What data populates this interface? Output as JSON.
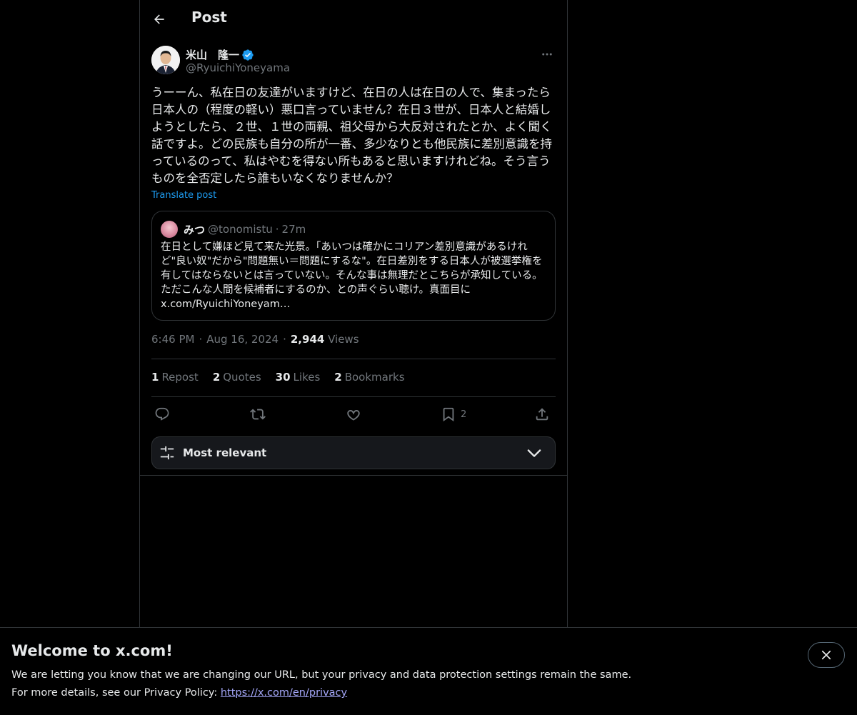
{
  "header": {
    "title": "Post"
  },
  "post": {
    "author": {
      "name": "米山　隆一",
      "handle": "@RyuichiYoneyama",
      "verified": true
    },
    "text": "うーーん、私在日の友達がいますけど、在日の人は在日の人で、集まったら日本人の（程度の軽い）悪口言っていません？在日３世が、日本人と結婚しようとしたら、２世、１世の両親、祖父母から大反対されたとか、よく聞く話ですよ。どの民族も自分の所が一番、多少なりとも他民族に差別意識を持っているのって、私はやむを得ない所もあると思いますけれどね。そう言うものを全否定したら誰もいなくなりませんか？",
    "translate_label": "Translate post",
    "quote": {
      "name": "みつ",
      "handle": "@tonomistu",
      "separator": "·",
      "time": "27m",
      "text": "在日として嫌ほど見て来た光景。「あいつは確かにコリアン差別意識があるけれど\"良い奴\"だから\"問題無い＝問題にするな\"。在日差別をする日本人が被選挙権を有してはならないとは言っていない。そんな事は無理だとこちらが承知している。ただこんな人間を候補者にするのか、との声ぐらい聴け。真面目に x.com/RyuichiYoneyam…"
    },
    "meta": {
      "time": "6:46 PM",
      "date": "Aug 16, 2024",
      "separator": "·",
      "views_count": "2,944",
      "views_label": "Views"
    },
    "stats": [
      {
        "count": "1",
        "label": "Repost"
      },
      {
        "count": "2",
        "label": "Quotes"
      },
      {
        "count": "30",
        "label": "Likes"
      },
      {
        "count": "2",
        "label": "Bookmarks"
      }
    ],
    "actions": {
      "reply_icon": "reply-icon",
      "repost_icon": "repost-icon",
      "like_icon": "heart-icon",
      "bookmark_icon": "bookmark-icon",
      "bookmark_count": "2",
      "share_icon": "share-icon"
    }
  },
  "sort": {
    "label": "Most relevant"
  },
  "banner": {
    "title": "Welcome to x.com!",
    "line1": "We are letting you know that we are changing our URL, but your privacy and data protection settings remain the same.",
    "line2_prefix": "For more details, see our Privacy Policy: ",
    "link": "https://x.com/en/privacy"
  },
  "colors": {
    "background": "#000000",
    "text": "#e7e9ea",
    "muted": "#71767b",
    "accent": "#1d9bf0",
    "border": "#2f3336",
    "link": "#a3a6f7"
  }
}
